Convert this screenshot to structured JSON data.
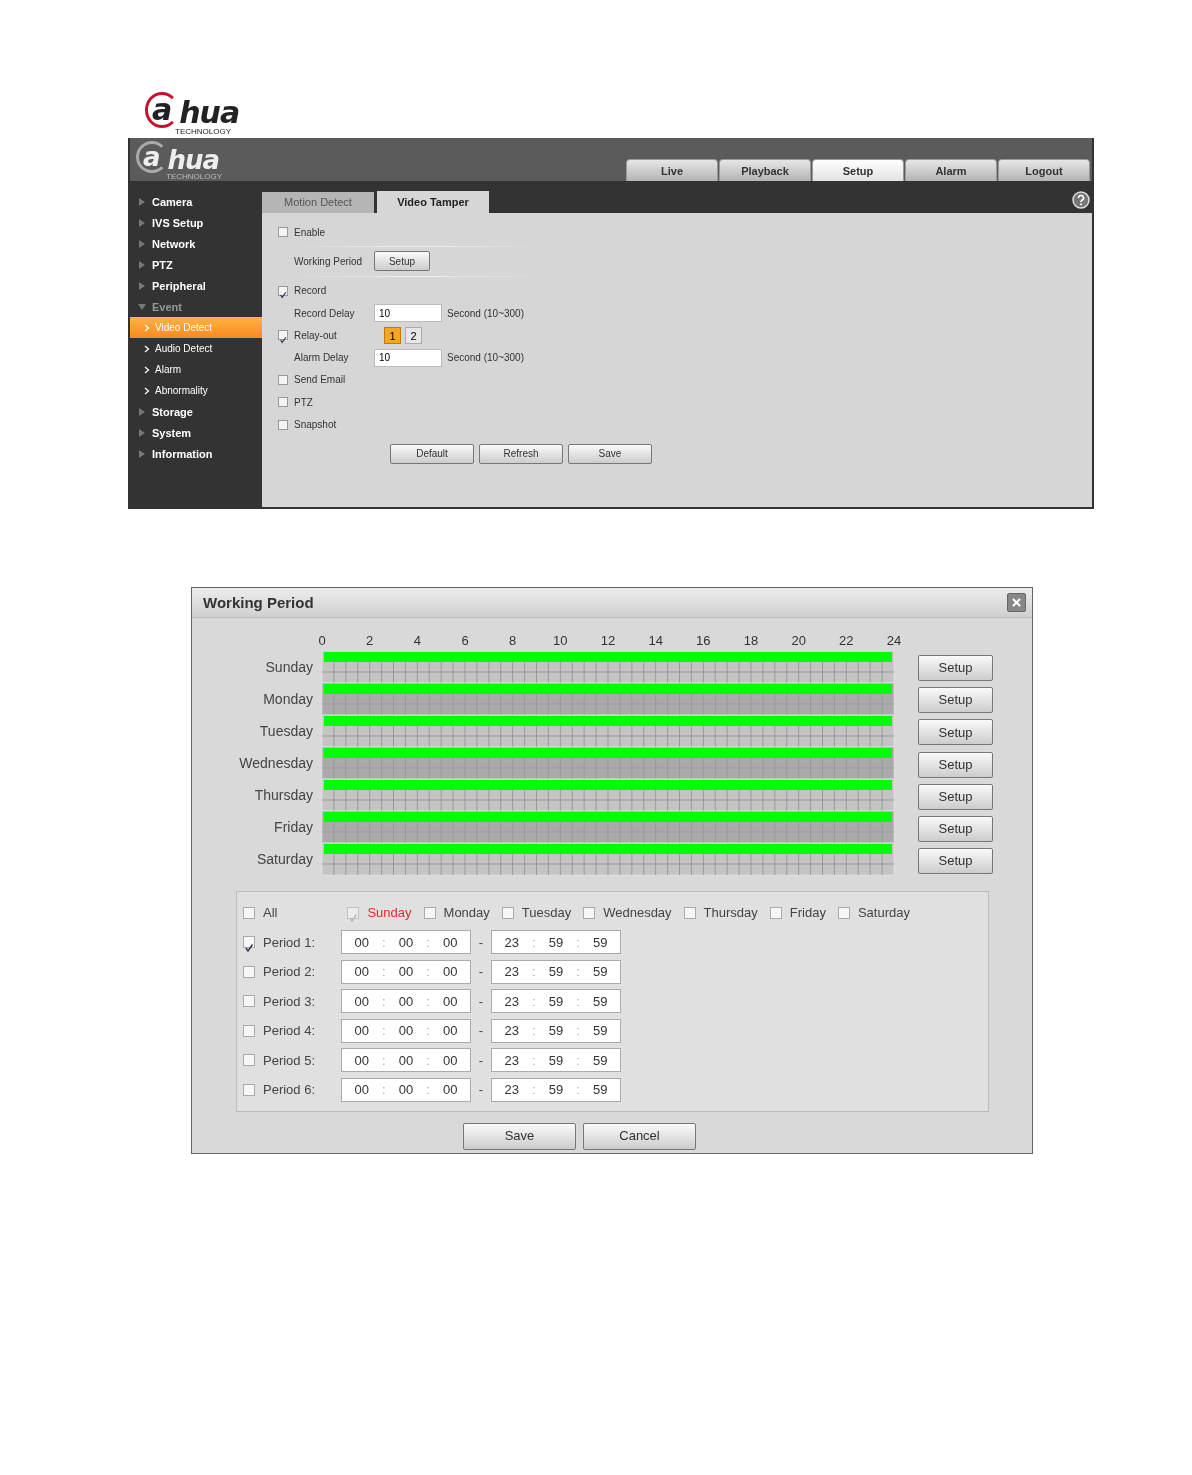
{
  "brand": {
    "mark": "a",
    "word": "hua",
    "tagline": "TECHNOLOGY"
  },
  "web_ui": {
    "header": {
      "brand": {
        "mark": "a",
        "word": "hua",
        "tagline": "TECHNOLOGY"
      },
      "nav": [
        {
          "label": "Live",
          "selected": false
        },
        {
          "label": "Playback",
          "selected": false
        },
        {
          "label": "Setup",
          "selected": true
        },
        {
          "label": "Alarm",
          "selected": false
        },
        {
          "label": "Logout",
          "selected": false
        }
      ]
    },
    "sidebar": {
      "items": [
        {
          "label": "Camera",
          "expanded": false
        },
        {
          "label": "IVS Setup",
          "expanded": false
        },
        {
          "label": "Network",
          "expanded": false
        },
        {
          "label": "PTZ",
          "expanded": false
        },
        {
          "label": "Peripheral",
          "expanded": false
        },
        {
          "label": "Event",
          "expanded": true,
          "children": [
            {
              "label": "Video Detect",
              "selected": true
            },
            {
              "label": "Audio Detect",
              "selected": false
            },
            {
              "label": "Alarm",
              "selected": false
            },
            {
              "label": "Abnormality",
              "selected": false
            }
          ]
        },
        {
          "label": "Storage",
          "expanded": false
        },
        {
          "label": "System",
          "expanded": false
        },
        {
          "label": "Information",
          "expanded": false
        }
      ]
    },
    "tabs": [
      {
        "label": "Motion Detect",
        "selected": false
      },
      {
        "label": "Video Tamper",
        "selected": true
      }
    ],
    "form": [
      {
        "kind": "checkbox",
        "label": "Enable",
        "checked": false
      },
      {
        "kind": "button",
        "label": "Working Period",
        "button": "Setup",
        "divided": true
      },
      {
        "kind": "checkbox",
        "label": "Record",
        "checked": true
      },
      {
        "kind": "field",
        "label": "Record Delay",
        "value": "10",
        "unit": "Second (10~300)"
      },
      {
        "kind": "relay",
        "label": "Relay-out",
        "checked": true,
        "channels": [
          {
            "label": "1",
            "selected": true
          },
          {
            "label": "2",
            "selected": false
          }
        ]
      },
      {
        "kind": "field",
        "label": "Alarm Delay",
        "value": "10",
        "unit": "Second (10~300)"
      },
      {
        "kind": "checkbox",
        "label": "Send Email",
        "checked": false
      },
      {
        "kind": "checkbox",
        "label": "PTZ",
        "checked": false
      },
      {
        "kind": "checkbox",
        "label": "Snapshot",
        "checked": false
      }
    ],
    "buttons": [
      "Default",
      "Refresh",
      "Save"
    ]
  },
  "dialog": {
    "title": "Working Period",
    "schedule": {
      "chart_data": {
        "type": "bar",
        "orientation": "horizontal",
        "categories": [
          "Sunday",
          "Monday",
          "Tuesday",
          "Wednesday",
          "Thursday",
          "Friday",
          "Saturday"
        ],
        "series": [
          {
            "color": "#00ff00",
            "values": [
              24,
              24,
              24,
              24,
              24,
              24,
              24
            ]
          }
        ],
        "xlim": [
          0,
          24
        ],
        "xticks": [
          0,
          2,
          4,
          6,
          8,
          10,
          12,
          14,
          16,
          18,
          20,
          22,
          24
        ]
      },
      "setup_buttons": [
        "Setup",
        "Setup",
        "Setup",
        "Setup",
        "Setup",
        "Setup",
        "Setup"
      ]
    },
    "all": {
      "label": "All",
      "checked": false
    },
    "days": [
      {
        "label": "Sunday",
        "checked": true,
        "disabled": true,
        "current": true
      },
      {
        "label": "Monday",
        "checked": false,
        "disabled": false,
        "current": false
      },
      {
        "label": "Tuesday",
        "checked": false,
        "disabled": false,
        "current": false
      },
      {
        "label": "Wednesday",
        "checked": false,
        "disabled": false,
        "current": false
      },
      {
        "label": "Thursday",
        "checked": false,
        "disabled": false,
        "current": false
      },
      {
        "label": "Friday",
        "checked": false,
        "disabled": false,
        "current": false
      },
      {
        "label": "Saturday",
        "checked": false,
        "disabled": false,
        "current": false
      }
    ],
    "periods": [
      {
        "label": "Period 1:",
        "checked": true,
        "start": [
          "00",
          "00",
          "00"
        ],
        "end": [
          "23",
          "59",
          "59"
        ]
      },
      {
        "label": "Period 2:",
        "checked": false,
        "start": [
          "00",
          "00",
          "00"
        ],
        "end": [
          "23",
          "59",
          "59"
        ]
      },
      {
        "label": "Period 3:",
        "checked": false,
        "start": [
          "00",
          "00",
          "00"
        ],
        "end": [
          "23",
          "59",
          "59"
        ]
      },
      {
        "label": "Period 4:",
        "checked": false,
        "start": [
          "00",
          "00",
          "00"
        ],
        "end": [
          "23",
          "59",
          "59"
        ]
      },
      {
        "label": "Period 5:",
        "checked": false,
        "start": [
          "00",
          "00",
          "00"
        ],
        "end": [
          "23",
          "59",
          "59"
        ]
      },
      {
        "label": "Period 6:",
        "checked": false,
        "start": [
          "00",
          "00",
          "00"
        ],
        "end": [
          "23",
          "59",
          "59"
        ]
      }
    ],
    "time_separator": ":",
    "range_separator": "-",
    "buttons": [
      "Save",
      "Cancel"
    ]
  }
}
